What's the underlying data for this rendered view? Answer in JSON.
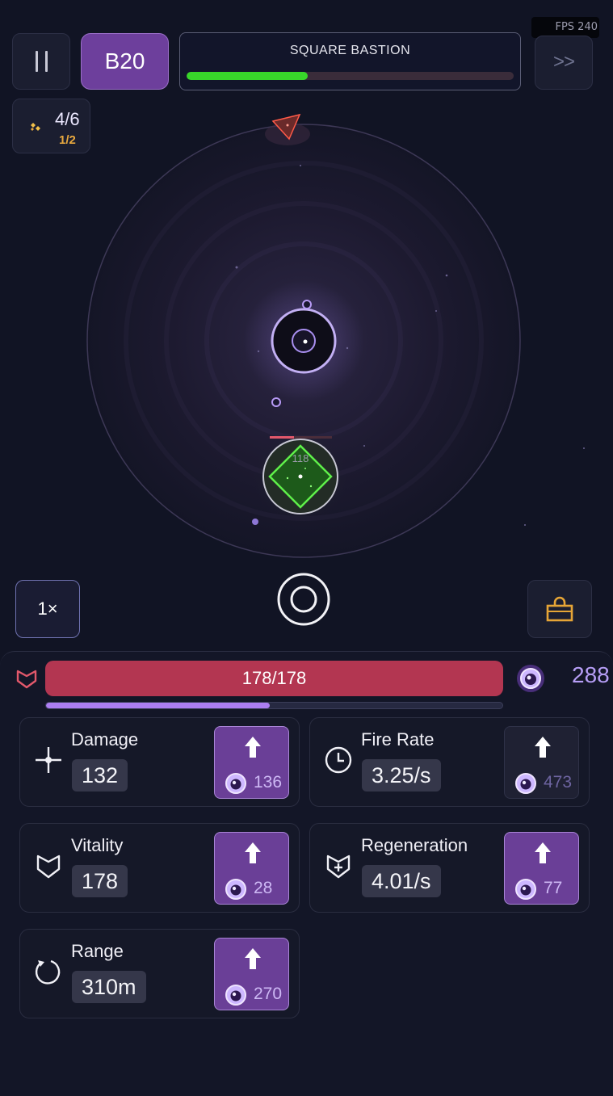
{
  "hud": {
    "fps": "FPS 240",
    "wave": "B20",
    "boss_name": "SQUARE BASTION",
    "boss_health_fraction": 0.37,
    "fast_forward": ">>",
    "units_count": "4/6",
    "units_sub": "1/2"
  },
  "arena": {
    "enemy_hp_label": "118",
    "colors": {
      "boss": "#43c62a",
      "core": "#b79af5",
      "enemy": "#e84b3a"
    }
  },
  "controls": {
    "speed": "1×"
  },
  "player": {
    "hp": "178/178",
    "hp_fraction": 1.0,
    "xp_fraction": 0.49,
    "gems": "288"
  },
  "stats": [
    {
      "name": "Damage",
      "value": "132",
      "cost": "136",
      "icon": "crosshair-icon",
      "affordable": true
    },
    {
      "name": "Fire Rate",
      "value": "3.25/s",
      "cost": "473",
      "icon": "clock-icon",
      "affordable": false
    },
    {
      "name": "Vitality",
      "value": "178",
      "cost": "28",
      "icon": "heart-icon",
      "affordable": true
    },
    {
      "name": "Regeneration",
      "value": "4.01/s",
      "cost": "77",
      "icon": "heart-plus-icon",
      "affordable": true
    },
    {
      "name": "Range",
      "value": "310m",
      "cost": "270",
      "icon": "range-icon",
      "affordable": true
    }
  ]
}
